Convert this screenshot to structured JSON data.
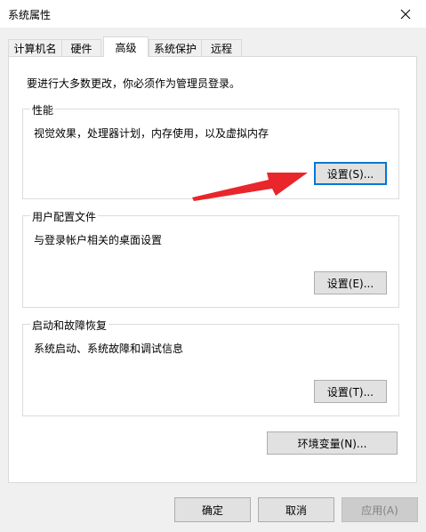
{
  "window": {
    "title": "系统属性"
  },
  "tabs": [
    {
      "label": "计算机名"
    },
    {
      "label": "硬件"
    },
    {
      "label": "高级"
    },
    {
      "label": "系统保护"
    },
    {
      "label": "远程"
    }
  ],
  "selected_tab": "高级",
  "admin_note": "要进行大多数更改，你必须作为管理员登录。",
  "performance": {
    "title": "性能",
    "description": "视觉效果，处理器计划，内存使用，以及虚拟内存",
    "settings_button": "设置(S)..."
  },
  "user_profiles": {
    "title": "用户配置文件",
    "description": "与登录帐户相关的桌面设置",
    "settings_button": "设置(E)..."
  },
  "startup_recovery": {
    "title": "启动和故障恢复",
    "description": "系统启动、系统故障和调试信息",
    "settings_button": "设置(T)..."
  },
  "env_vars_button": "环境变量(N)...",
  "footer": {
    "ok": "确定",
    "cancel": "取消",
    "apply": "应用(A)"
  },
  "colors": {
    "annotation_arrow": "#e8262b",
    "focus_border": "#0078d7"
  }
}
